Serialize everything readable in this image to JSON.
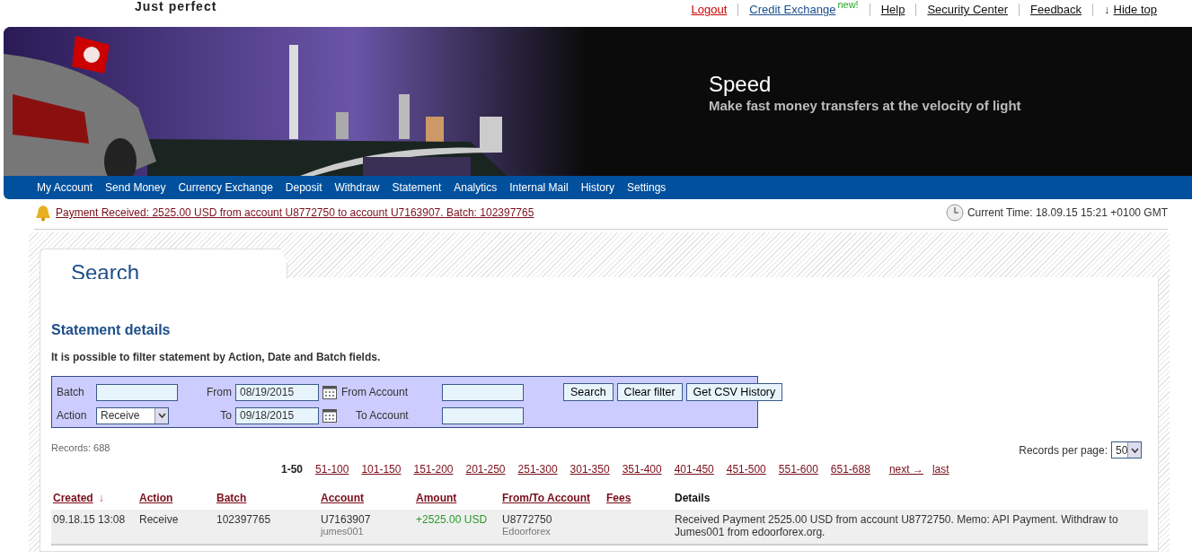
{
  "brand": {
    "tagline": "Just perfect"
  },
  "top_links": [
    {
      "label": "Logout",
      "kind": "danger"
    },
    {
      "label": "Credit Exchange",
      "kind": "info",
      "badge": "new!"
    },
    {
      "label": "Help",
      "kind": "plain"
    },
    {
      "label": "Security Center",
      "kind": "plain"
    },
    {
      "label": "Feedback",
      "kind": "plain"
    },
    {
      "label": "Hide top",
      "kind": "plain",
      "icon": "↓"
    }
  ],
  "banner": {
    "title": "Speed",
    "subtitle": "Make fast money transfers at the velocity of light"
  },
  "nav": [
    "My Account",
    "Send Money",
    "Currency Exchange",
    "Deposit",
    "Withdraw",
    "Statement",
    "Analytics",
    "Internal Mail",
    "History",
    "Settings"
  ],
  "notice": {
    "text": "Payment Received: 2525.00 USD from account U8772750 to account U7163907. Batch: 102397765",
    "time": "Current Time: 18.09.15 15:21 +0100 GMT"
  },
  "panel": {
    "tab": "Search",
    "title": "Statement details",
    "hint": "It is possible to filter statement by Action, Date and Batch fields."
  },
  "filter": {
    "batch": {
      "label": "Batch"
    },
    "action": {
      "label": "Action",
      "value": "Receive"
    },
    "from": {
      "label": "From",
      "value": "08/19/2015"
    },
    "to": {
      "label": "To",
      "value": "09/18/2015"
    },
    "from_account": {
      "label": "From Account"
    },
    "to_account": {
      "label": "To Account"
    },
    "buttons": [
      "Search",
      "Clear filter",
      "Get CSV History"
    ]
  },
  "records": {
    "count": "Records: 688",
    "per_page_label": "Records per page:",
    "per_page": "50"
  },
  "pager": {
    "pages": [
      {
        "label": "1-50",
        "selected": true
      },
      {
        "label": "51-100",
        "selected": false
      },
      {
        "label": "101-150",
        "selected": false
      },
      {
        "label": "151-200",
        "selected": false
      },
      {
        "label": "201-250",
        "selected": false
      },
      {
        "label": "251-300",
        "selected": false
      },
      {
        "label": "301-350",
        "selected": false
      },
      {
        "label": "351-400",
        "selected": false
      },
      {
        "label": "401-450",
        "selected": false
      },
      {
        "label": "451-500",
        "selected": false
      },
      {
        "label": "551-600",
        "selected": false
      },
      {
        "label": "651-688",
        "selected": false
      }
    ],
    "next": "next →",
    "last": "last"
  },
  "table": {
    "columns": [
      {
        "label": "Created",
        "kind": "link",
        "sort": "↓"
      },
      {
        "label": "Action",
        "kind": "link"
      },
      {
        "label": "Batch",
        "kind": "link"
      },
      {
        "label": "Account",
        "kind": "link"
      },
      {
        "label": "Amount",
        "kind": "link"
      },
      {
        "label": "From/To Account",
        "kind": "link"
      },
      {
        "label": "Fees",
        "kind": "link"
      },
      {
        "label": "Details",
        "kind": "plain"
      }
    ],
    "rows": [
      {
        "created": "09.18.15 13:08",
        "action": "Receive",
        "batch": "102397765",
        "account": "U7163907",
        "account_name": "jumes001",
        "amount": "+2525.00 USD",
        "counterparty": "U8772750",
        "counterparty_name": "Edoorforex",
        "details": "Received Payment 2525.00 USD from account U8772750. Memo: API Payment. Withdraw to Jumes001 from edoorforex.org."
      }
    ]
  }
}
